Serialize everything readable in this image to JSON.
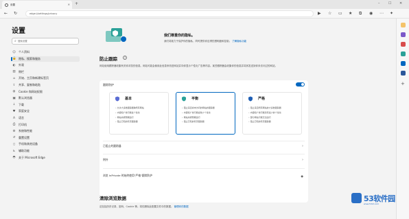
{
  "browser": {
    "tab_title": "设置",
    "url": "edge://settings/privacy",
    "window_controls": [
      "–",
      "☐",
      "✕"
    ]
  },
  "sidebar": {
    "title": "设置",
    "search_placeholder": "搜索设置",
    "items": [
      {
        "label": "个人资料",
        "icon": "user-icon"
      },
      {
        "label": "隐私、搜索和服务",
        "icon": "lock-icon",
        "active": true
      },
      {
        "label": "外观",
        "icon": "palette-icon"
      },
      {
        "label": "侧栏",
        "icon": "sidebar-icon"
      },
      {
        "label": "开始、主页和新建标签页",
        "icon": "home-icon"
      },
      {
        "label": "共享、复制和粘贴",
        "icon": "share-icon"
      },
      {
        "label": "Cookie 和网站权限",
        "icon": "cookie-icon"
      },
      {
        "label": "默认浏览器",
        "icon": "browser-icon"
      },
      {
        "label": "下载",
        "icon": "download-icon"
      },
      {
        "label": "家庭安全",
        "icon": "family-icon"
      },
      {
        "label": "语言",
        "icon": "language-icon"
      },
      {
        "label": "打印机",
        "icon": "printer-icon"
      },
      {
        "label": "系统和性能",
        "icon": "system-icon"
      },
      {
        "label": "重置设置",
        "icon": "reset-icon"
      },
      {
        "label": "手机和其他设备",
        "icon": "phone-icon"
      },
      {
        "label": "辅助功能",
        "icon": "accessibility-icon"
      },
      {
        "label": "关于 Microsoft Edge",
        "icon": "edge-icon"
      }
    ]
  },
  "banner": {
    "title": "我们尊重你的隐私。",
    "text": "我们将致力于保护你的隐私，同时提供你应得的透明度和控制。",
    "link": "了解隐私功能"
  },
  "tracking": {
    "title": "防止跟踪",
    "help": "?",
    "description": "网站使用跟踪器收集有关你浏览的信息。网站可能会使用此信息来改进网站并向你显示个性化广告等内容。某些跟踪器会收集你的信息并将其发送到你未访问过的网站。",
    "toggle_label": "跟踪防护",
    "toggle_on": true,
    "options": [
      {
        "title": "基本",
        "icon": "basic-shield-icon",
        "items": [
          "允许大多数跟踪器跨所有网站",
          "内容和广告可能会个性化",
          "网站将按预期运行",
          "阻止已知的有害跟踪器"
        ]
      },
      {
        "title": "平衡",
        "icon": "balanced-shield-icon",
        "selected": true,
        "items": [
          "阻止来自尚未访问的网站的跟踪器",
          "内容和广告可能会较少个性化",
          "网站将按预期运行",
          "阻止已知的有害跟踪器"
        ]
      },
      {
        "title": "严格",
        "icon": "strict-shield-icon",
        "items": [
          "阻止来自所有网站的大多数跟踪器",
          "内容和广告可能具有最少的个性化",
          "部分网站可能无法运行",
          "阻止已知的有害跟踪器"
        ]
      }
    ],
    "rows": [
      {
        "label": "已阻止的跟踪器"
      },
      {
        "label": "例外"
      },
      {
        "label": "浏览 InPrivate 时始终使用\"严格\"跟踪防护"
      }
    ]
  },
  "clear_data": {
    "title": "清除浏览数据",
    "description": "这包括历史记录、密码、Cookie 等。将仅删除此配置文件中的数据。",
    "link": "管理你的数据"
  },
  "watermark": {
    "brand": "53软件园",
    "sub": "www.53xt.com"
  },
  "colors": {
    "accent": "#0067c0",
    "watermark": "#2a6fc6"
  }
}
